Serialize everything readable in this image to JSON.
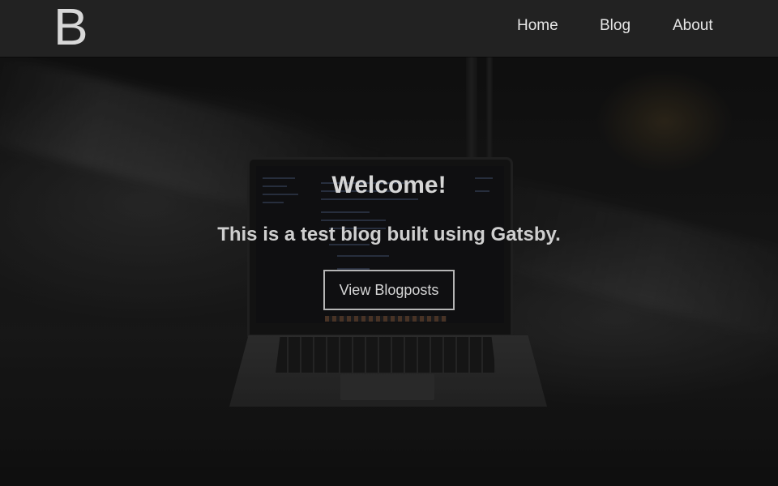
{
  "header": {
    "logo_text": "B",
    "nav": [
      {
        "label": "Home"
      },
      {
        "label": "Blog"
      },
      {
        "label": "About"
      }
    ]
  },
  "hero": {
    "title": "Welcome!",
    "subtitle": "This is a test blog built using Gatsby.",
    "cta_label": "View Blogposts",
    "background_image": "laptop-in-dark-room"
  },
  "colors": {
    "header_bg": "#222222",
    "text": "#d6d6d6"
  }
}
